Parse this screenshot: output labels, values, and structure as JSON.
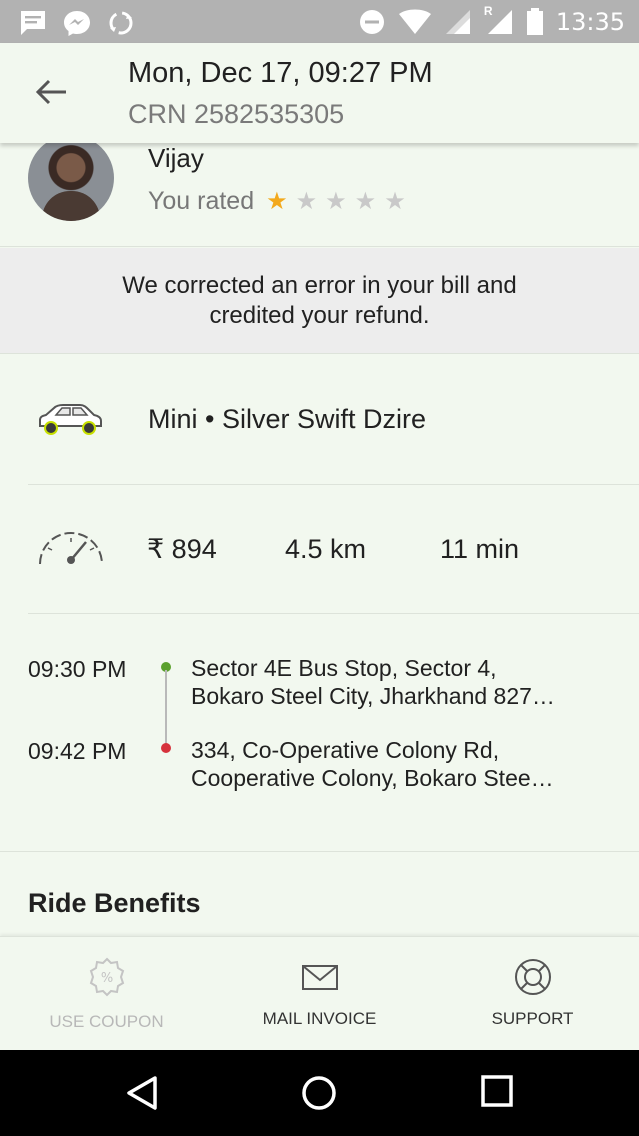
{
  "status_bar": {
    "time": "13:35",
    "left_icons": [
      "message-icon",
      "messenger-icon",
      "sync-icon"
    ],
    "right_icons": [
      "do-not-disturb-icon",
      "wifi-icon",
      "signal-icon",
      "roaming-signal-icon",
      "battery-icon"
    ],
    "roaming_label": "R"
  },
  "header": {
    "title": "Mon, Dec 17, 09:27 PM",
    "subtitle": "CRN 2582535305"
  },
  "driver": {
    "name": "Vijay",
    "rated_label": "You rated",
    "rating": 1,
    "rating_max": 5,
    "star_glyph": "★"
  },
  "notice": {
    "text": "We corrected an error in your bill and credited your refund."
  },
  "car": {
    "description": "Mini • Silver Swift Dzire"
  },
  "stats": {
    "fare": "₹ 894",
    "distance": "4.5 km",
    "duration": "11 min"
  },
  "route": {
    "pickup": {
      "time": "09:30 PM",
      "address_line1": "Sector 4E Bus Stop, Sector 4,",
      "address_line2": "Bokaro Steel City, Jharkhand 827…"
    },
    "drop": {
      "time": "09:42 PM",
      "address_line1": "334, Co-Operative Colony Rd,",
      "address_line2": "Cooperative Colony, Bokaro Stee…"
    }
  },
  "benefits": {
    "title": "Ride Benefits"
  },
  "actions": {
    "coupon": "USE COUPON",
    "invoice": "MAIL INVOICE",
    "support": "SUPPORT"
  },
  "colors": {
    "background": "#f2f8ef",
    "status_bar": "#b2b2b2",
    "star_active": "#f3a91c",
    "pickup_dot": "#5aa02c",
    "drop_dot": "#d6323c",
    "disabled_text": "#b8b8b8"
  }
}
